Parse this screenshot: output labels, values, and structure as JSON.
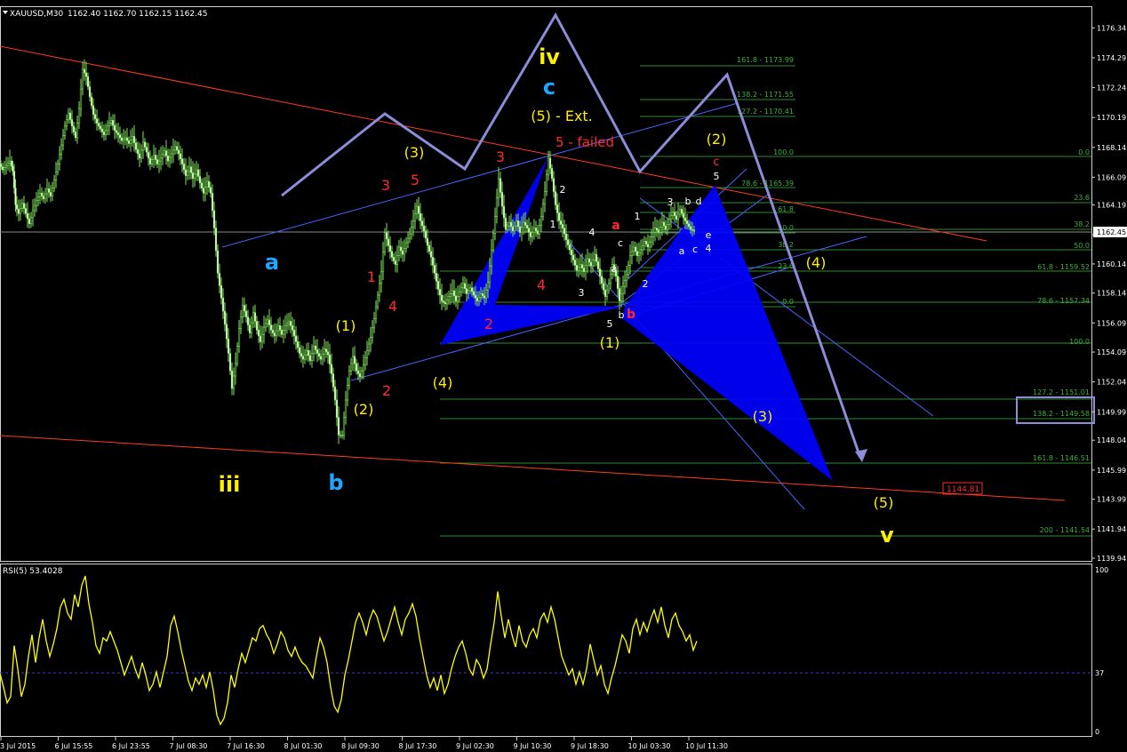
{
  "header": {
    "symbol": "XAUUSD,M30",
    "ohlc": "1162.40 1162.70 1162.15 1162.45"
  },
  "price_axis": {
    "ticks": [
      "1176.34",
      "1174.29",
      "1172.24",
      "1170.19",
      "1168.14",
      "1166.09",
      "1164.19",
      "1162.14",
      "1160.14",
      "1158.14",
      "1156.09",
      "1154.09",
      "1152.04",
      "1149.99",
      "1148.04",
      "1145.99",
      "1143.99",
      "1141.94",
      "1139.94"
    ],
    "current_price": "1162.45",
    "target_box": "1144.81"
  },
  "time_axis": {
    "labels": [
      "3 Jul 2015",
      "6 Jul 15:55",
      "6 Jul 23:55",
      "7 Jul 08:30",
      "7 Jul 16:30",
      "8 Jul 01:30",
      "8 Jul 09:30",
      "8 Jul 17:30",
      "9 Jul 02:30",
      "9 Jul 10:30",
      "9 Jul 18:30",
      "10 Jul 03:30",
      "10 Jul 11:30"
    ]
  },
  "fib_labels": {
    "l1": "161.8 - 1173.99",
    "l2": "138.2 - 1171.55",
    "l3": "127.2 - 1170.41",
    "l4": "100.0",
    "l5": "0.0",
    "l6": "78.6 - 1165.39",
    "l7": "23.6",
    "l8": "61.8",
    "l9": "38.2",
    "l10": "50.0",
    "l11": "50.0",
    "l12": "38.2",
    "l13": "61.8 - 1159.52",
    "l14": "23.6",
    "l15": "0.0",
    "l16": "78.6 - 1157.34",
    "l17": "100.0",
    "l18": "127.2 - 1151.01",
    "l19": "138.2 - 1149.58",
    "l20": "161.8 - 1146.51",
    "l21": "200 - 1141.54"
  },
  "wave_labels": {
    "iv": "iv",
    "c_blue": "c",
    "ext": "(5) - Ext.",
    "failed": "5 - failed",
    "w3_top": "(3)",
    "w5_red": "5",
    "w3_red": "3",
    "w2_top": "(2)",
    "c_red": "c",
    "a_blue": "a",
    "w1_red": "1",
    "w4_red": "4",
    "w1_paren": "(1)",
    "w2_red": "2",
    "w4_paren": "(4)",
    "w2_paren": "(2)",
    "iii": "iii",
    "b_blue": "b",
    "w3_red2": "3",
    "w2_red2": "2",
    "w4_red2": "4",
    "a_red": "a",
    "b_red": "b",
    "w1_paren2": "(1)",
    "w4_right": "(4)",
    "w3_right": "(3)",
    "w5_right": "(5)",
    "v": "v"
  },
  "small_labels": {
    "s2": "2",
    "s1": "1",
    "s4": "4",
    "s3": "3",
    "s5": "5",
    "sc": "c",
    "sa": "a",
    "sb": "b",
    "s1b": "1",
    "s2b": "2",
    "s3b": "3",
    "sbb": "b",
    "sd": "d",
    "s5b": "5",
    "se": "e",
    "s4b": "4",
    "sa2": "a",
    "sc2": "c"
  },
  "rsi": {
    "label": "RSI(5) 53.4028",
    "levels": [
      "100",
      "37",
      "0"
    ]
  },
  "colors": {
    "candles": "#7fe05a",
    "rsi_line": "#ffff00",
    "pattern_fill": "#0000ff",
    "projection_arrow": "#8c8cd8",
    "trendline": "#ff3b1f",
    "channel": "#4b63ff",
    "fib": "#2f8a2f",
    "label_yellow": "#ffee00",
    "label_red": "#ff2a2a",
    "label_blue": "#1ea7ff"
  },
  "chart_data": {
    "type": "candlestick",
    "symbol": "XAUUSD",
    "timeframe": "M30",
    "ylim": [
      1139.94,
      1177.4
    ],
    "close_path": [
      [
        0,
        1167.0
      ],
      [
        4,
        1166.6
      ],
      [
        8,
        1166.9
      ],
      [
        12,
        1167.2
      ],
      [
        15,
        1166.5
      ],
      [
        18,
        1164.2
      ],
      [
        22,
        1163.6
      ],
      [
        26,
        1164.3
      ],
      [
        30,
        1163.6
      ],
      [
        34,
        1162.9
      ],
      [
        38,
        1163.8
      ],
      [
        42,
        1164.5
      ],
      [
        46,
        1165.0
      ],
      [
        50,
        1164.6
      ],
      [
        54,
        1165.3
      ],
      [
        58,
        1164.8
      ],
      [
        62,
        1165.9
      ],
      [
        66,
        1167.0
      ],
      [
        70,
        1168.3
      ],
      [
        74,
        1169.6
      ],
      [
        78,
        1170.5
      ],
      [
        82,
        1169.6
      ],
      [
        86,
        1168.8
      ],
      [
        90,
        1170.8
      ],
      [
        94,
        1173.5
      ],
      [
        98,
        1173.0
      ],
      [
        102,
        1171.6
      ],
      [
        106,
        1170.4
      ],
      [
        110,
        1169.8
      ],
      [
        114,
        1169.4
      ],
      [
        118,
        1169.0
      ],
      [
        122,
        1169.6
      ],
      [
        126,
        1170.0
      ],
      [
        130,
        1169.3
      ],
      [
        134,
        1169.0
      ],
      [
        138,
        1168.6
      ],
      [
        142,
        1168.8
      ],
      [
        146,
        1168.4
      ],
      [
        150,
        1168.9
      ],
      [
        154,
        1168.0
      ],
      [
        158,
        1167.4
      ],
      [
        162,
        1168.5
      ],
      [
        166,
        1167.8
      ],
      [
        170,
        1167.0
      ],
      [
        174,
        1167.6
      ],
      [
        178,
        1167.0
      ],
      [
        182,
        1167.4
      ],
      [
        186,
        1167.9
      ],
      [
        190,
        1167.2
      ],
      [
        194,
        1167.7
      ],
      [
        198,
        1168.2
      ],
      [
        202,
        1167.7
      ],
      [
        206,
        1167.0
      ],
      [
        210,
        1166.2
      ],
      [
        214,
        1166.8
      ],
      [
        218,
        1166.0
      ],
      [
        222,
        1166.6
      ],
      [
        226,
        1165.7
      ],
      [
        230,
        1165.0
      ],
      [
        234,
        1165.8
      ],
      [
        238,
        1165.0
      ],
      [
        242,
        1162.6
      ],
      [
        246,
        1159.5
      ],
      [
        250,
        1157.8
      ],
      [
        254,
        1156.0
      ],
      [
        258,
        1154.0
      ],
      [
        262,
        1151.6
      ],
      [
        266,
        1153.3
      ],
      [
        270,
        1155.7
      ],
      [
        274,
        1157.3
      ],
      [
        278,
        1156.5
      ],
      [
        282,
        1155.4
      ],
      [
        286,
        1156.8
      ],
      [
        290,
        1155.6
      ],
      [
        294,
        1154.8
      ],
      [
        298,
        1155.8
      ],
      [
        302,
        1156.3
      ],
      [
        306,
        1155.6
      ],
      [
        310,
        1155.2
      ],
      [
        314,
        1155.9
      ],
      [
        318,
        1155.3
      ],
      [
        322,
        1155.9
      ],
      [
        326,
        1156.2
      ],
      [
        330,
        1155.6
      ],
      [
        334,
        1154.8
      ],
      [
        338,
        1154.0
      ],
      [
        342,
        1153.6
      ],
      [
        346,
        1154.2
      ],
      [
        350,
        1153.5
      ],
      [
        354,
        1154.5
      ],
      [
        358,
        1154.0
      ],
      [
        362,
        1153.6
      ],
      [
        366,
        1154.3
      ],
      [
        370,
        1153.9
      ],
      [
        374,
        1152.6
      ],
      [
        378,
        1150.8
      ],
      [
        382,
        1148.4
      ],
      [
        386,
        1148.4
      ],
      [
        390,
        1150.8
      ],
      [
        394,
        1152.8
      ],
      [
        398,
        1153.8
      ],
      [
        402,
        1152.8
      ],
      [
        406,
        1152.4
      ],
      [
        410,
        1153.2
      ],
      [
        414,
        1154.2
      ],
      [
        418,
        1155.1
      ],
      [
        422,
        1156.4
      ],
      [
        426,
        1158.0
      ],
      [
        430,
        1159.6
      ],
      [
        434,
        1162.3
      ],
      [
        438,
        1161.4
      ],
      [
        442,
        1160.6
      ],
      [
        446,
        1160.1
      ],
      [
        450,
        1161.3
      ],
      [
        454,
        1160.8
      ],
      [
        458,
        1161.6
      ],
      [
        462,
        1162.2
      ],
      [
        466,
        1163.1
      ],
      [
        470,
        1164.1
      ],
      [
        474,
        1163.1
      ],
      [
        478,
        1162.4
      ],
      [
        482,
        1161.4
      ],
      [
        486,
        1160.6
      ],
      [
        490,
        1159.5
      ],
      [
        494,
        1158.4
      ],
      [
        498,
        1157.6
      ],
      [
        502,
        1157.4
      ],
      [
        506,
        1157.9
      ],
      [
        510,
        1158.3
      ],
      [
        514,
        1157.6
      ],
      [
        518,
        1158.2
      ],
      [
        522,
        1158.8
      ],
      [
        526,
        1158.1
      ],
      [
        530,
        1158.5
      ],
      [
        534,
        1158.0
      ],
      [
        538,
        1157.6
      ],
      [
        542,
        1158.1
      ],
      [
        546,
        1157.8
      ],
      [
        550,
        1158.9
      ],
      [
        554,
        1161.1
      ],
      [
        558,
        1163.4
      ],
      [
        562,
        1166.0
      ],
      [
        566,
        1164.1
      ],
      [
        570,
        1162.5
      ],
      [
        574,
        1163.0
      ],
      [
        578,
        1162.4
      ],
      [
        582,
        1163.1
      ],
      [
        586,
        1162.3
      ],
      [
        590,
        1163.0
      ],
      [
        594,
        1162.6
      ],
      [
        598,
        1162.0
      ],
      [
        602,
        1162.6
      ],
      [
        606,
        1162.2
      ],
      [
        610,
        1163.4
      ],
      [
        614,
        1165.1
      ],
      [
        618,
        1167.4
      ],
      [
        622,
        1166.0
      ],
      [
        626,
        1164.2
      ],
      [
        630,
        1163.1
      ],
      [
        634,
        1162.6
      ],
      [
        638,
        1161.8
      ],
      [
        642,
        1161.1
      ],
      [
        646,
        1160.4
      ],
      [
        650,
        1159.7
      ],
      [
        654,
        1160.1
      ],
      [
        658,
        1159.6
      ],
      [
        662,
        1160.5
      ],
      [
        666,
        1160.0
      ],
      [
        670,
        1160.8
      ],
      [
        674,
        1159.8
      ],
      [
        678,
        1158.8
      ],
      [
        682,
        1157.9
      ],
      [
        686,
        1158.8
      ],
      [
        690,
        1160.1
      ],
      [
        694,
        1159.3
      ],
      [
        698,
        1157.6
      ],
      [
        702,
        1158.6
      ],
      [
        706,
        1159.4
      ],
      [
        710,
        1160.7
      ],
      [
        714,
        1161.3
      ],
      [
        718,
        1160.7
      ],
      [
        722,
        1161.1
      ],
      [
        726,
        1161.7
      ],
      [
        730,
        1161.3
      ],
      [
        734,
        1162.0
      ],
      [
        738,
        1162.6
      ],
      [
        742,
        1162.3
      ],
      [
        746,
        1163.0
      ],
      [
        750,
        1162.5
      ],
      [
        754,
        1163.2
      ],
      [
        758,
        1163.7
      ],
      [
        762,
        1163.2
      ],
      [
        766,
        1163.9
      ],
      [
        770,
        1163.3
      ],
      [
        774,
        1162.9
      ],
      [
        778,
        1162.5
      ],
      [
        782,
        1162.4
      ]
    ],
    "rsi_path": [
      [
        0,
        37
      ],
      [
        4,
        28
      ],
      [
        8,
        18
      ],
      [
        12,
        22
      ],
      [
        16,
        55
      ],
      [
        20,
        40
      ],
      [
        24,
        22
      ],
      [
        28,
        30
      ],
      [
        32,
        48
      ],
      [
        36,
        62
      ],
      [
        40,
        44
      ],
      [
        44,
        60
      ],
      [
        48,
        72
      ],
      [
        52,
        58
      ],
      [
        56,
        48
      ],
      [
        60,
        56
      ],
      [
        64,
        66
      ],
      [
        68,
        80
      ],
      [
        72,
        85
      ],
      [
        76,
        76
      ],
      [
        80,
        72
      ],
      [
        84,
        88
      ],
      [
        88,
        80
      ],
      [
        92,
        94
      ],
      [
        96,
        100
      ],
      [
        100,
        82
      ],
      [
        104,
        70
      ],
      [
        108,
        55
      ],
      [
        112,
        50
      ],
      [
        116,
        60
      ],
      [
        120,
        58
      ],
      [
        124,
        64
      ],
      [
        128,
        58
      ],
      [
        132,
        52
      ],
      [
        136,
        44
      ],
      [
        140,
        36
      ],
      [
        144,
        42
      ],
      [
        148,
        48
      ],
      [
        152,
        40
      ],
      [
        156,
        34
      ],
      [
        160,
        44
      ],
      [
        164,
        36
      ],
      [
        168,
        26
      ],
      [
        172,
        30
      ],
      [
        176,
        38
      ],
      [
        180,
        28
      ],
      [
        184,
        38
      ],
      [
        188,
        48
      ],
      [
        192,
        68
      ],
      [
        196,
        74
      ],
      [
        200,
        64
      ],
      [
        204,
        52
      ],
      [
        208,
        42
      ],
      [
        212,
        32
      ],
      [
        216,
        26
      ],
      [
        220,
        34
      ],
      [
        224,
        30
      ],
      [
        228,
        36
      ],
      [
        232,
        28
      ],
      [
        236,
        38
      ],
      [
        240,
        26
      ],
      [
        244,
        10
      ],
      [
        248,
        4
      ],
      [
        252,
        8
      ],
      [
        256,
        18
      ],
      [
        260,
        36
      ],
      [
        264,
        28
      ],
      [
        268,
        40
      ],
      [
        272,
        50
      ],
      [
        276,
        44
      ],
      [
        280,
        52
      ],
      [
        284,
        60
      ],
      [
        288,
        58
      ],
      [
        292,
        66
      ],
      [
        296,
        68
      ],
      [
        300,
        62
      ],
      [
        304,
        58
      ],
      [
        308,
        50
      ],
      [
        312,
        56
      ],
      [
        316,
        64
      ],
      [
        320,
        60
      ],
      [
        324,
        52
      ],
      [
        328,
        48
      ],
      [
        332,
        54
      ],
      [
        336,
        48
      ],
      [
        340,
        44
      ],
      [
        344,
        42
      ],
      [
        348,
        38
      ],
      [
        352,
        34
      ],
      [
        356,
        48
      ],
      [
        360,
        60
      ],
      [
        364,
        54
      ],
      [
        368,
        44
      ],
      [
        372,
        28
      ],
      [
        376,
        16
      ],
      [
        380,
        12
      ],
      [
        384,
        20
      ],
      [
        388,
        36
      ],
      [
        392,
        46
      ],
      [
        396,
        58
      ],
      [
        400,
        70
      ],
      [
        404,
        76
      ],
      [
        408,
        70
      ],
      [
        412,
        62
      ],
      [
        416,
        72
      ],
      [
        420,
        78
      ],
      [
        424,
        74
      ],
      [
        428,
        66
      ],
      [
        432,
        58
      ],
      [
        436,
        64
      ],
      [
        440,
        72
      ],
      [
        444,
        80
      ],
      [
        448,
        70
      ],
      [
        452,
        62
      ],
      [
        456,
        72
      ],
      [
        460,
        76
      ],
      [
        464,
        82
      ],
      [
        468,
        74
      ],
      [
        472,
        60
      ],
      [
        476,
        48
      ],
      [
        480,
        36
      ],
      [
        484,
        28
      ],
      [
        488,
        34
      ],
      [
        492,
        26
      ],
      [
        496,
        36
      ],
      [
        500,
        24
      ],
      [
        504,
        30
      ],
      [
        508,
        40
      ],
      [
        512,
        48
      ],
      [
        516,
        54
      ],
      [
        520,
        58
      ],
      [
        524,
        50
      ],
      [
        528,
        40
      ],
      [
        532,
        36
      ],
      [
        536,
        46
      ],
      [
        540,
        42
      ],
      [
        544,
        34
      ],
      [
        548,
        40
      ],
      [
        552,
        56
      ],
      [
        556,
        70
      ],
      [
        560,
        90
      ],
      [
        564,
        74
      ],
      [
        568,
        60
      ],
      [
        572,
        72
      ],
      [
        576,
        62
      ],
      [
        580,
        54
      ],
      [
        584,
        68
      ],
      [
        588,
        58
      ],
      [
        592,
        54
      ],
      [
        596,
        62
      ],
      [
        600,
        66
      ],
      [
        604,
        60
      ],
      [
        608,
        72
      ],
      [
        612,
        76
      ],
      [
        616,
        70
      ],
      [
        620,
        80
      ],
      [
        624,
        72
      ],
      [
        628,
        60
      ],
      [
        632,
        48
      ],
      [
        636,
        42
      ],
      [
        640,
        36
      ],
      [
        644,
        40
      ],
      [
        648,
        30
      ],
      [
        652,
        38
      ],
      [
        656,
        30
      ],
      [
        660,
        40
      ],
      [
        664,
        56
      ],
      [
        668,
        46
      ],
      [
        672,
        36
      ],
      [
        676,
        42
      ],
      [
        680,
        30
      ],
      [
        684,
        24
      ],
      [
        688,
        34
      ],
      [
        692,
        42
      ],
      [
        696,
        52
      ],
      [
        700,
        62
      ],
      [
        704,
        58
      ],
      [
        708,
        50
      ],
      [
        712,
        66
      ],
      [
        716,
        72
      ],
      [
        720,
        62
      ],
      [
        724,
        70
      ],
      [
        728,
        64
      ],
      [
        732,
        72
      ],
      [
        736,
        78
      ],
      [
        740,
        70
      ],
      [
        744,
        80
      ],
      [
        748,
        68
      ],
      [
        752,
        60
      ],
      [
        756,
        72
      ],
      [
        760,
        76
      ],
      [
        764,
        68
      ],
      [
        768,
        64
      ],
      [
        772,
        58
      ],
      [
        776,
        62
      ],
      [
        780,
        52
      ],
      [
        784,
        58
      ]
    ]
  }
}
